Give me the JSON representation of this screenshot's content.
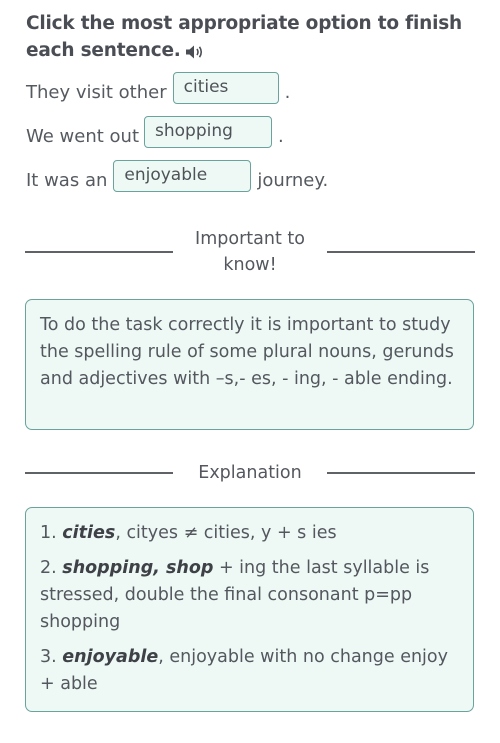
{
  "instruction": {
    "title": "Click the most appropriate option to finish each sentence.",
    "audio_icon": "speaker-icon"
  },
  "sentences": [
    {
      "before": "They visit other",
      "answer": "cities",
      "after": "."
    },
    {
      "before": "We went out",
      "answer": "shopping",
      "after": "."
    },
    {
      "before": "It was an",
      "answer": "enjoyable",
      "after": "journey."
    }
  ],
  "important": {
    "heading": "Important to know!",
    "text": "To do the task correctly it is important to study the spelling rule of some plural nouns, gerunds and adjectives with –s,- es, - ing, - able ending."
  },
  "explanation": {
    "heading": "Explanation",
    "items": [
      {
        "number": "1.",
        "bold": "cities",
        "text": ", cityes ≠ cities, y + s ies"
      },
      {
        "number": "2.",
        "bold": "shopping, shop",
        "text": " + ing the last syllable is stressed, double the final consonant p=pp shopping"
      },
      {
        "number": "3.",
        "bold": "enjoyable",
        "text": ", enjoyable with no change enjoy + able"
      }
    ]
  },
  "colors": {
    "accent_border": "#6aa39e",
    "box_fill": "#eef8f5",
    "text": "#555a60"
  }
}
